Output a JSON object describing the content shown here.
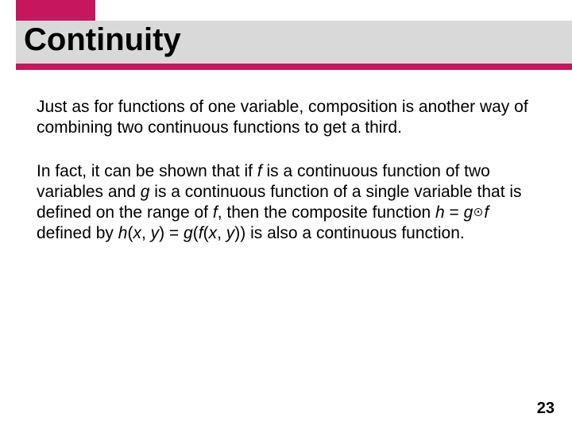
{
  "title": "Continuity",
  "para1": "Just as for functions of one variable, composition is another way of combining two continuous functions to get a third.",
  "p2": {
    "t1": "In fact, it can be shown that if ",
    "f1": "f",
    "t2": " is a continuous function of two variables and ",
    "g1": "g",
    "t3": " is a continuous function of a single variable that is defined on the range of ",
    "f2": "f",
    "t4": ", then the composite function ",
    "h1": "h",
    "t5": " = ",
    "g2": "g",
    "f3": "f",
    "t6": " defined by ",
    "h2": "h",
    "t7": "(",
    "x1": "x",
    "t8": ", ",
    "y1": "y",
    "t9": ") = ",
    "g3": "g",
    "t10": "(",
    "f4": "f",
    "t11": "(",
    "x2": "x",
    "t12": ", ",
    "y2": "y",
    "t13": ")) is also a continuous function."
  },
  "page": "23"
}
